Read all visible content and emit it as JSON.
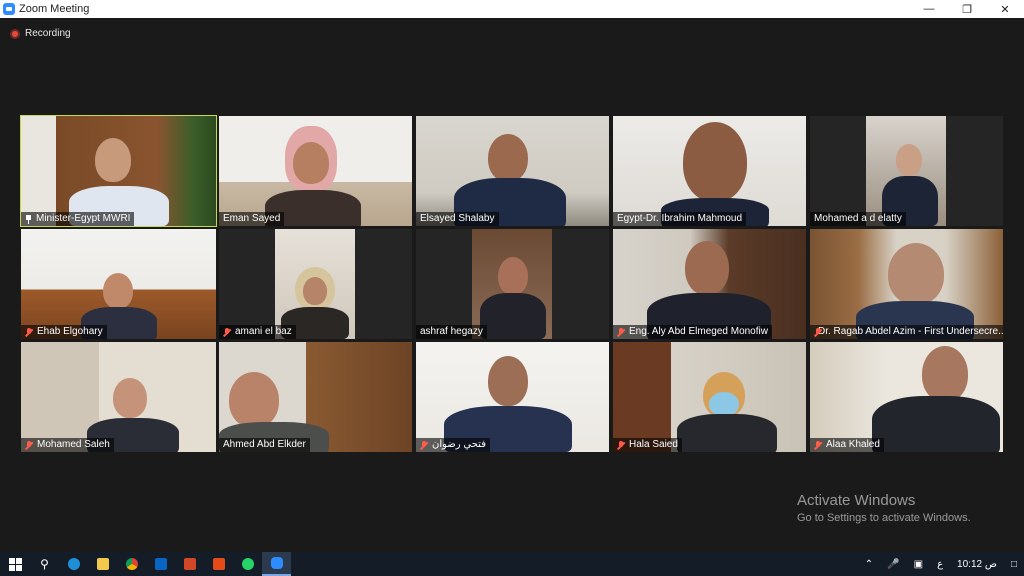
{
  "window": {
    "title": "Zoom Meeting",
    "controls": [
      "minimize",
      "maximize",
      "close"
    ]
  },
  "meeting": {
    "recording_label": "Recording"
  },
  "participants": [
    {
      "name": "Minister-Egypt MWRI",
      "indicator": "pin",
      "active_speaker": true
    },
    {
      "name": "Eman Sayed",
      "indicator": "none"
    },
    {
      "name": "Elsayed Shalaby",
      "indicator": "none"
    },
    {
      "name": "Egypt-Dr. Ibrahim Mahmoud",
      "indicator": "none"
    },
    {
      "name": "Mohamed a d elatty",
      "indicator": "none"
    },
    {
      "name": "Ehab Elgohary",
      "indicator": "muted"
    },
    {
      "name": "amani el baz",
      "indicator": "muted"
    },
    {
      "name": "ashraf hegazy",
      "indicator": "none"
    },
    {
      "name": "Eng. Aly Abd Elmeged Monofiw",
      "indicator": "muted"
    },
    {
      "name": "Dr. Ragab Abdel Azim - First Undersecre...",
      "indicator": "muted"
    },
    {
      "name": "Mohamed Saleh",
      "indicator": "muted"
    },
    {
      "name": "Ahmed Abd Elkder",
      "indicator": "none"
    },
    {
      "name": "فتحي رضوان",
      "indicator": "muted"
    },
    {
      "name": "Hala Saied",
      "indicator": "muted"
    },
    {
      "name": "Alaa Khaled",
      "indicator": "muted"
    }
  ],
  "watermark": {
    "line1": "Activate Windows",
    "line2": "Go to Settings to activate Windows."
  },
  "taskbar": {
    "apps": [
      "start-icon",
      "search-icon",
      "edge-icon",
      "file-explorer-icon",
      "chrome-icon",
      "outlook-icon",
      "powerpoint-icon",
      "office-icon",
      "whatsapp-icon",
      "zoom-icon"
    ],
    "tray": {
      "lang": "ع",
      "time": "10:12",
      "ampm": "ص"
    }
  },
  "colors": {
    "active_speaker_border": "#c7d94a",
    "muted_mic": "#ff5a4a",
    "recording_dot": "#e24a3a",
    "zoom_blue": "#2d8cff"
  }
}
